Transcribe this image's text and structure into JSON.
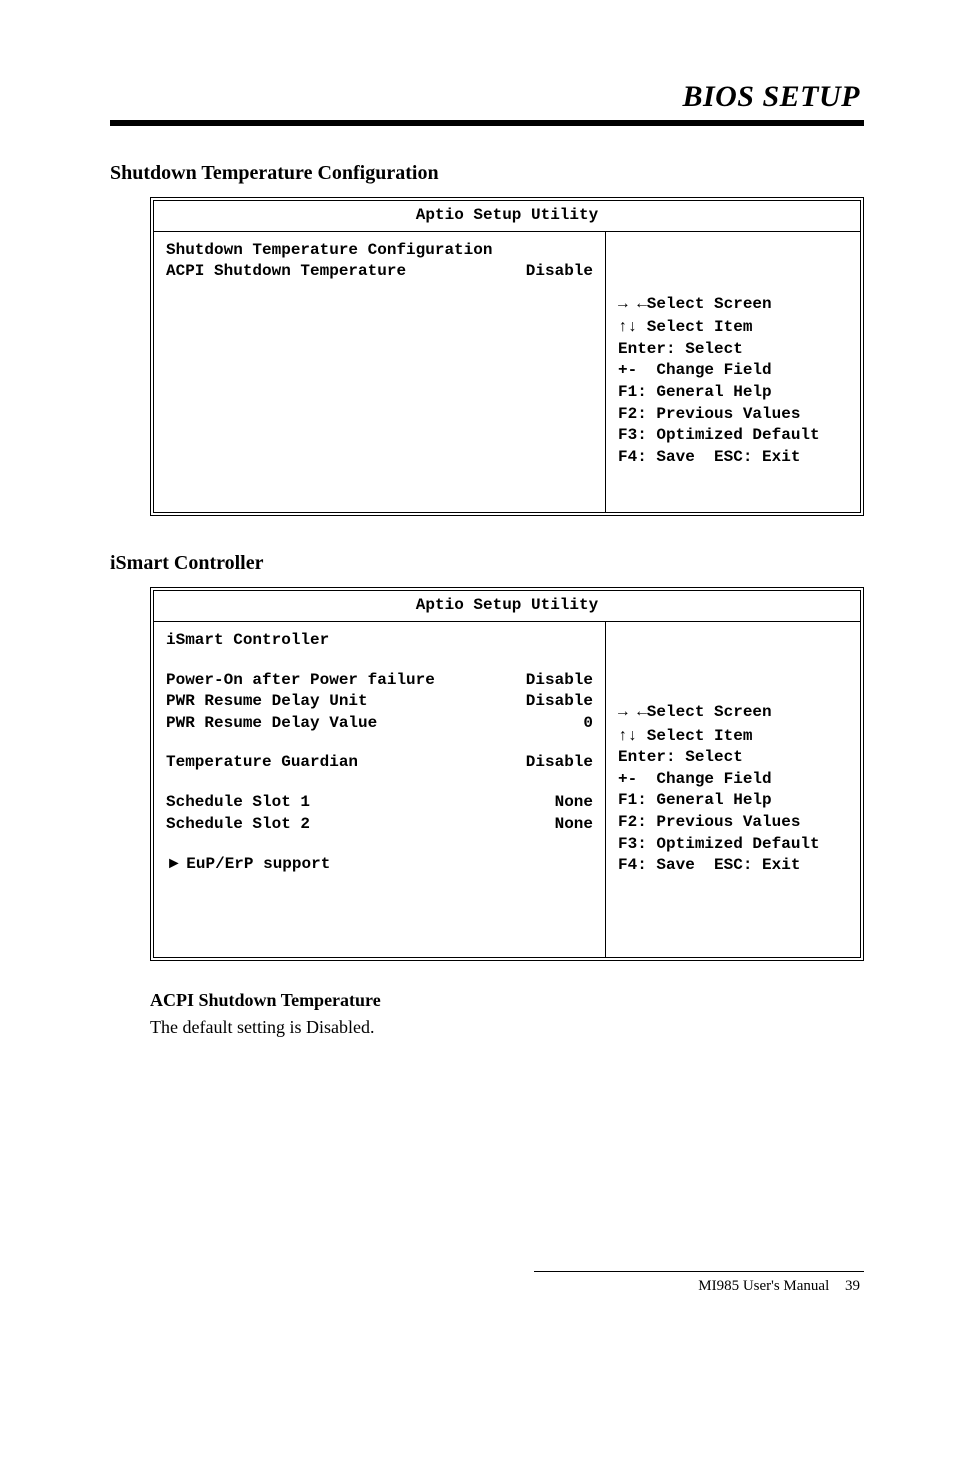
{
  "header": {
    "title": "BIOS SETUP"
  },
  "section1": {
    "heading": "Shutdown Temperature Configuration",
    "box": {
      "title": "Aptio Setup Utility",
      "left": {
        "row1_label": "Shutdown Temperature Configuration",
        "row2_label": "ACPI Shutdown Temperature",
        "row2_value": "Disable"
      },
      "right": {
        "l1": "→ ←Select Screen",
        "l2": "↑↓ Select Item",
        "l3": "Enter: Select",
        "l4": "+-  Change Field",
        "l5": "F1: General Help",
        "l6": "F2: Previous Values",
        "l7": "F3: Optimized Default",
        "l8": "F4: Save  ESC: Exit"
      }
    }
  },
  "section2": {
    "heading": "iSmart Controller",
    "box": {
      "title": "Aptio Setup Utility",
      "left": {
        "r1_label": "iSmart Controller",
        "r2_label": "Power-On after Power failure",
        "r2_value": "Disable",
        "r3_label": "PWR Resume Delay Unit",
        "r3_value": "Disable",
        "r4_label": "PWR Resume Delay Value",
        "r4_value": "0",
        "r5_label": "Temperature Guardian",
        "r5_value": "Disable",
        "r6_label": "Schedule Slot 1",
        "r6_value": "None",
        "r7_label": "Schedule Slot 2",
        "r7_value": "None",
        "r8_label": "EuP/ErP support"
      },
      "right": {
        "l1": "→ ←Select Screen",
        "l2": "↑↓ Select Item",
        "l3": "Enter: Select",
        "l4": "+-  Change Field",
        "l5": "F1: General Help",
        "l6": "F2: Previous Values",
        "l7": "F3: Optimized Default",
        "l8": "F4: Save  ESC: Exit"
      }
    }
  },
  "note": {
    "label": "ACPI Shutdown Temperature",
    "text": "The default setting is Disabled."
  },
  "footer": {
    "product": "MI985 User's Manual",
    "page": "39"
  }
}
